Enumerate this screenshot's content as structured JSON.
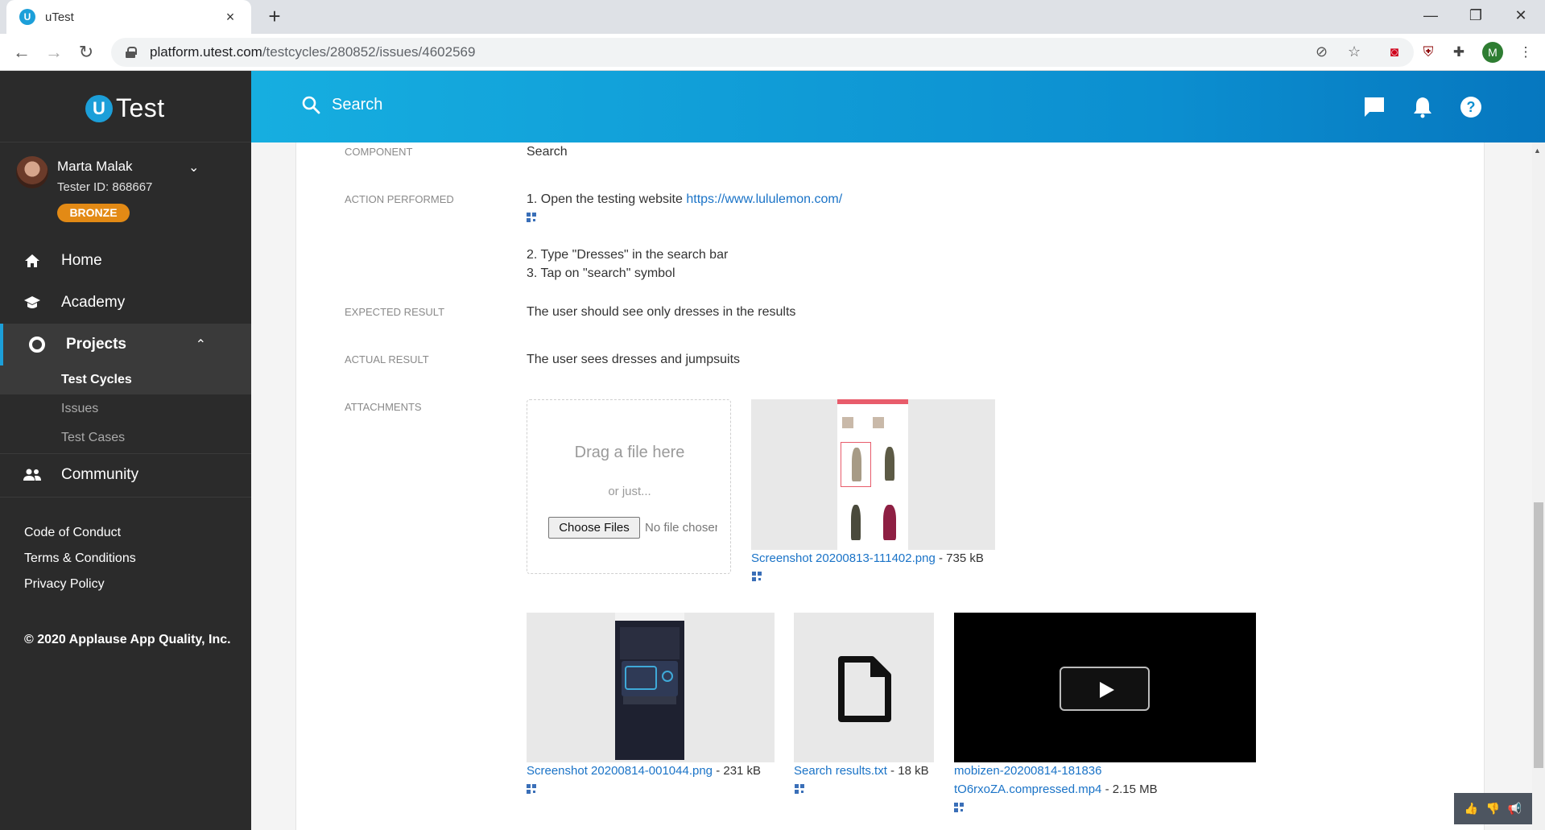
{
  "browser": {
    "tab_title": "uTest",
    "tab_favicon": "U",
    "close_tab": "×",
    "new_tab": "+",
    "url_host": "platform.utest.com",
    "url_path": "/testcycles/280852/issues/4602569",
    "profile_initial": "M",
    "window_controls": {
      "minimize": "—",
      "restore": "❐",
      "close": "✕"
    }
  },
  "header": {
    "search_label": "Search",
    "icons": [
      "chat-icon",
      "bell-icon",
      "help-icon"
    ]
  },
  "sidebar": {
    "logo_u": "U",
    "logo_text": "Test",
    "user": {
      "name": "Marta Malak",
      "tester_id": "Tester ID: 868667",
      "badge": "BRONZE"
    },
    "nav": [
      {
        "label": "Home",
        "icon": "home-icon"
      },
      {
        "label": "Academy",
        "icon": "graduation-cap-icon"
      },
      {
        "label": "Projects",
        "icon": "projects-icon"
      },
      {
        "label": "Community",
        "icon": "people-icon"
      }
    ],
    "subnav": [
      "Test Cycles",
      "Issues",
      "Test Cases"
    ],
    "footer_links": [
      "Code of Conduct",
      "Terms & Conditions",
      "Privacy Policy"
    ],
    "copyright": "© 2020 Applause App Quality, Inc."
  },
  "issue": {
    "component_label": "COMPONENT",
    "component_value": "Search",
    "action_label": "ACTION PERFORMED",
    "action_step1_text": "1. Open the testing website ",
    "action_step1_link": "https://www.lululemon.com/",
    "action_step2": "2. Type \"Dresses\" in the search bar",
    "action_step3": "3. Tap on \"search\" symbol",
    "expected_label": "EXPECTED RESULT",
    "expected_value": "The user should see only dresses in the results",
    "actual_label": "ACTUAL RESULT",
    "actual_value": "The user sees dresses and jumpsuits",
    "attachments_label": "ATTACHMENTS"
  },
  "dropzone": {
    "title": "Drag a file here",
    "subtitle": "or just...",
    "button": "Choose Files",
    "no_file": "No file chosen"
  },
  "attachments": [
    {
      "name": "Screenshot 20200813-111402.png",
      "size": " - 735 kB"
    },
    {
      "name": "Screenshot 20200814-001044.png",
      "size": " - 231 kB"
    },
    {
      "name": "Search results.txt",
      "size": " - 18 kB"
    },
    {
      "name_line1": "mobizen-20200814-181836",
      "name_line2": "tO6rxoZA.compressed.mp4",
      "size": " - 2.15 MB"
    }
  ]
}
